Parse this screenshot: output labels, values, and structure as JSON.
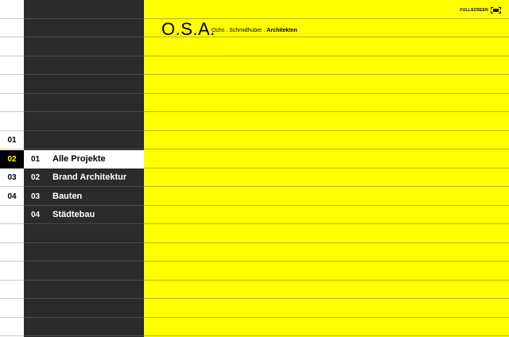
{
  "brand": {
    "logo": "O.S.A.",
    "tagline_part1": "Ochs . Schmidhuber . ",
    "tagline_part2": "Architekten"
  },
  "toolbar": {
    "fullscreen_label": "FULLSCREEN"
  },
  "level_nav": {
    "items": [
      "01",
      "02",
      "03",
      "04"
    ],
    "active": "02"
  },
  "menu": {
    "items": [
      {
        "num": "01",
        "label": "Alle Projekte"
      },
      {
        "num": "02",
        "label": "Brand Architektur"
      },
      {
        "num": "03",
        "label": "Bauten"
      },
      {
        "num": "04",
        "label": "Städtebau"
      }
    ],
    "active_index": 0
  },
  "colors": {
    "accent": "#ffff00",
    "dark": "#2b2b2b",
    "light": "#ffffff"
  }
}
